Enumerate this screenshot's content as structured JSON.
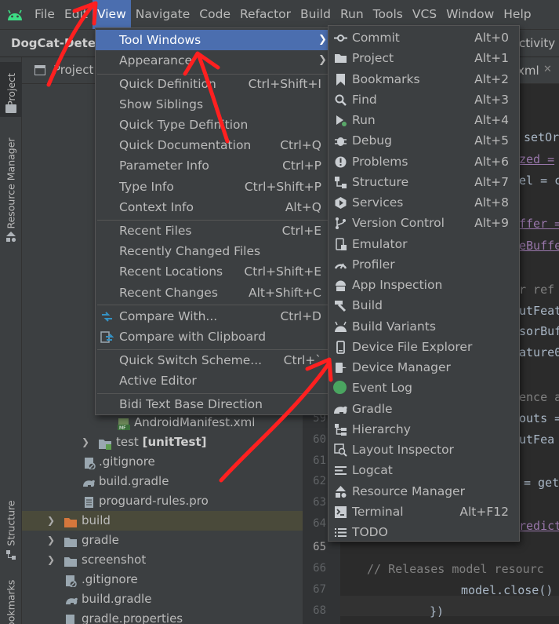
{
  "menubar": {
    "items": [
      {
        "label": "File"
      },
      {
        "label": "Edit"
      },
      {
        "label": "View"
      },
      {
        "label": "Navigate"
      },
      {
        "label": "Code"
      },
      {
        "label": "Refactor"
      },
      {
        "label": "Build"
      },
      {
        "label": "Run"
      },
      {
        "label": "Tools"
      },
      {
        "label": "VCS"
      },
      {
        "label": "Window"
      },
      {
        "label": "Help"
      }
    ],
    "active": "View"
  },
  "navbar": {
    "project": "DogCat-Detec",
    "right_fragment": "ctivity"
  },
  "toolstrip": {
    "project": "Project",
    "resource_manager": "Resource Manager",
    "structure": "Structure",
    "bookmarks": "Bookmarks"
  },
  "project_panel": {
    "header": "Project",
    "rows": [
      {
        "label": "AndroidManifest.xml",
        "badge": "MF"
      },
      {
        "label": "test",
        "suffix": "[unitTest]"
      },
      {
        "label": ".gitignore"
      },
      {
        "label": "build.gradle"
      },
      {
        "label": "proguard-rules.pro"
      },
      {
        "label": "build"
      },
      {
        "label": "gradle"
      },
      {
        "label": "screenshot"
      },
      {
        "label": ".gitignore"
      },
      {
        "label": "build.gradle"
      },
      {
        "label": "gradle.properties"
      }
    ]
  },
  "editor": {
    "tab": "xml",
    "line_numbers": [
      "59",
      "60",
      "61",
      "62",
      "63",
      "64",
      "65",
      "66",
      "67",
      "68"
    ],
    "code": {
      "l1": "setOr",
      "l2": "zed =",
      "l3": "el = c",
      "l4": "ffer =",
      "l5": "eBuffe",
      "l6": "r ref",
      "l7": "utFeat",
      "l8": "sorBuf",
      "l9": "ature0",
      "l10": "ence a",
      "l11": "outs =",
      "l12": "utFea",
      "l13": "= get",
      "l14": "redict",
      "l15": "// Releases model resourc",
      "l16": "model.close()",
      "l17": "})"
    }
  },
  "view_menu": {
    "items": [
      {
        "label": "Tool Windows",
        "mnemonic": "T",
        "submenu": true
      },
      {
        "label": "Appearance",
        "mnemonic": "A",
        "submenu": true
      },
      {
        "label": "Quick Definition",
        "shortcut": "Ctrl+Shift+I"
      },
      {
        "label": "Show Siblings"
      },
      {
        "label": "Quick Type Definition"
      },
      {
        "label": "Quick Documentation",
        "shortcut": "Ctrl+Q"
      },
      {
        "label": "Parameter Info",
        "shortcut": "Ctrl+P"
      },
      {
        "label": "Type Info",
        "shortcut": "Ctrl+Shift+P"
      },
      {
        "label": "Context Info",
        "shortcut": "Alt+Q"
      },
      {
        "label": "Recent Files",
        "shortcut": "Ctrl+E"
      },
      {
        "label": "Recently Changed Files"
      },
      {
        "label": "Recent Locations",
        "shortcut": "Ctrl+Shift+E"
      },
      {
        "label": "Recent Changes",
        "shortcut": "Alt+Shift+C"
      },
      {
        "label": "Compare With...",
        "shortcut": "Ctrl+D"
      },
      {
        "label": "Compare with Clipboard"
      },
      {
        "label": "Quick Switch Scheme...",
        "shortcut": "Ctrl+`"
      },
      {
        "label": "Active Editor",
        "submenu": true
      },
      {
        "label": "Bidi Text Base Direction",
        "submenu": true
      }
    ]
  },
  "tool_windows_menu": {
    "items": [
      {
        "label": "Commit",
        "shortcut": "Alt+0",
        "icon": "commit-icon"
      },
      {
        "label": "Project",
        "shortcut": "Alt+1",
        "icon": "folder-icon"
      },
      {
        "label": "Bookmarks",
        "shortcut": "Alt+2",
        "icon": "bookmark-icon"
      },
      {
        "label": "Find",
        "shortcut": "Alt+3",
        "icon": "search-icon"
      },
      {
        "label": "Run",
        "shortcut": "Alt+4",
        "icon": "run-icon"
      },
      {
        "label": "Debug",
        "shortcut": "Alt+5",
        "icon": "bug-icon"
      },
      {
        "label": "Problems",
        "shortcut": "Alt+6",
        "icon": "warning-icon"
      },
      {
        "label": "Structure",
        "shortcut": "Alt+7",
        "icon": "structure-icon"
      },
      {
        "label": "Services",
        "shortcut": "Alt+8",
        "icon": "services-icon"
      },
      {
        "label": "Version Control",
        "shortcut": "Alt+9",
        "icon": "branch-icon"
      },
      {
        "label": "Emulator",
        "icon": "emulator-icon"
      },
      {
        "label": "Profiler",
        "icon": "gauge-icon"
      },
      {
        "label": "App Inspection",
        "icon": "android-inspect-icon"
      },
      {
        "label": "Build",
        "icon": "hammer-icon"
      },
      {
        "label": "Build Variants",
        "icon": "android-icon"
      },
      {
        "label": "Device File Explorer",
        "icon": "phone-icon"
      },
      {
        "label": "Device Manager",
        "icon": "device-manager-icon"
      },
      {
        "label": "Event Log",
        "icon": "event-log-icon"
      },
      {
        "label": "Gradle",
        "icon": "gradle-icon"
      },
      {
        "label": "Hierarchy",
        "icon": "hierarchy-icon"
      },
      {
        "label": "Layout Inspector",
        "icon": "layout-inspector-icon"
      },
      {
        "label": "Logcat",
        "icon": "logcat-icon"
      },
      {
        "label": "Resource Manager",
        "icon": "resource-manager-icon"
      },
      {
        "label": "Terminal",
        "shortcut": "Alt+F12",
        "icon": "terminal-icon"
      },
      {
        "label": "TODO",
        "icon": "list-icon"
      }
    ]
  },
  "colors": {
    "highlight": "#4b6eaf",
    "menu_bg": "#3c3f41",
    "annotation_red": "#ff2020"
  }
}
